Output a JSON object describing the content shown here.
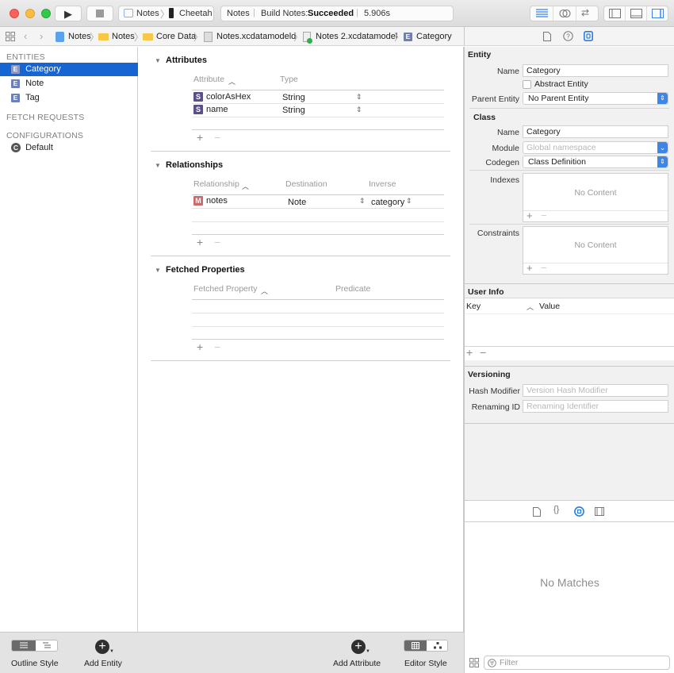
{
  "toolbar": {
    "scheme": "Notes",
    "device": "Cheetah",
    "activity_project": "Notes",
    "activity_prefix": "Build Notes:",
    "activity_status": "Succeeded",
    "activity_time": "5.906s"
  },
  "jumpbar": {
    "items": [
      "Notes",
      "Notes",
      "Core Data",
      "Notes.xcdatamodeld",
      "Notes 2.xcdatamodel",
      "Category"
    ]
  },
  "sidebar": {
    "entities_header": "ENTITIES",
    "entities": [
      {
        "badge": "E",
        "label": "Category",
        "selected": true
      },
      {
        "badge": "E",
        "label": "Note",
        "selected": false
      },
      {
        "badge": "E",
        "label": "Tag",
        "selected": false
      }
    ],
    "fetch_requests_header": "FETCH REQUESTS",
    "configurations_header": "CONFIGURATIONS",
    "configurations": [
      {
        "badge": "C",
        "label": "Default"
      }
    ]
  },
  "editor": {
    "attributes": {
      "title": "Attributes",
      "col_attribute": "Attribute",
      "col_type": "Type",
      "rows": [
        {
          "badge": "S",
          "name": "colorAsHex",
          "type": "String"
        },
        {
          "badge": "S",
          "name": "name",
          "type": "String"
        }
      ]
    },
    "relationships": {
      "title": "Relationships",
      "col_relationship": "Relationship",
      "col_destination": "Destination",
      "col_inverse": "Inverse",
      "rows": [
        {
          "badge": "M",
          "name": "notes",
          "destination": "Note",
          "inverse": "category"
        }
      ]
    },
    "fetched_properties": {
      "title": "Fetched Properties",
      "col_fetched_property": "Fetched Property",
      "col_predicate": "Predicate"
    },
    "plus": "+",
    "minus": "−"
  },
  "inspector": {
    "entity_header": "Entity",
    "name_label": "Name",
    "name_value": "Category",
    "abstract_label": "Abstract Entity",
    "abstract_checked": false,
    "parent_label": "Parent Entity",
    "parent_value": "No Parent Entity",
    "class_header": "Class",
    "class_name_label": "Name",
    "class_name_value": "Category",
    "module_label": "Module",
    "module_placeholder": "Global namespace",
    "codegen_label": "Codegen",
    "codegen_value": "Class Definition",
    "indexes_label": "Indexes",
    "indexes_empty": "No Content",
    "constraints_label": "Constraints",
    "constraints_empty": "No Content",
    "userinfo_header": "User Info",
    "key_col": "Key",
    "value_col": "Value",
    "versioning_header": "Versioning",
    "hash_label": "Hash Modifier",
    "hash_placeholder": "Version Hash Modifier",
    "renaming_label": "Renaming ID",
    "renaming_placeholder": "Renaming Identifier"
  },
  "library": {
    "empty": "No Matches",
    "filter_placeholder": "Filter"
  },
  "bottombar": {
    "outline_style": "Outline Style",
    "add_entity": "Add Entity",
    "add_attribute": "Add Attribute",
    "editor_style": "Editor Style"
  },
  "colors": {
    "accent": "#1765d3",
    "entity_badge": "#6d7fb8",
    "string_badge": "#5c4e86",
    "relationship_badge": "#c86a6e"
  }
}
